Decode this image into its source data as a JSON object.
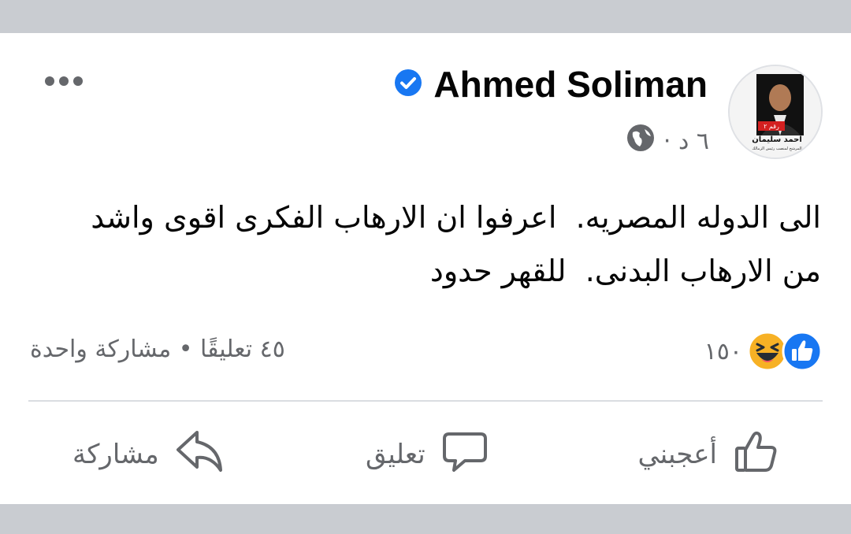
{
  "post": {
    "author": "Ahmed Soliman",
    "time": "٦ د ·",
    "text": "الى الدوله المصريه.  اعرفوا ان الارهاب الفكرى اقوى واشد\nمن الارهاب البدنى.  للقهر حدود",
    "avatar": {
      "badge": "رقم ٢",
      "name": "احمد سليمان",
      "caption": "المرشح لمنصب رئيس الزمالك"
    }
  },
  "reactions": {
    "count": "١٥٠",
    "types": [
      "like",
      "haha"
    ]
  },
  "stats": {
    "text": "٤٥ تعليقًا • مشاركة واحدة"
  },
  "actions": {
    "like": "أعجبني",
    "comment": "تعليق",
    "share": "مشاركة"
  },
  "colors": {
    "verified": "#1877f2",
    "like_blue": "#1877f2",
    "haha_yellow": "#f7b125",
    "secondary_text": "#65676b",
    "background": "#c9ccd1"
  },
  "icons": [
    "verified-badge-icon",
    "globe-icon",
    "more-options-icon",
    "like-reaction-icon",
    "haha-reaction-icon",
    "thumbs-up-icon",
    "comment-icon",
    "share-icon"
  ]
}
